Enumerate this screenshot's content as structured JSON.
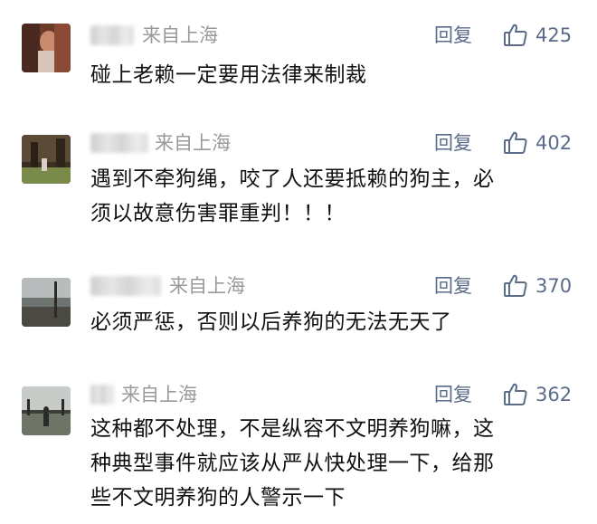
{
  "comments": [
    {
      "location": "来自上海",
      "reply_label": "回复",
      "likes": "425",
      "lines": [
        "碰上老赖一定要用法律来制裁"
      ]
    },
    {
      "location": "来自上海",
      "reply_label": "回复",
      "likes": "402",
      "lines": [
        "遇到不牵狗绳，咬了人还要抵赖的狗主，必",
        "须以故意伤害罪重判！！！"
      ]
    },
    {
      "location": "来自上海",
      "reply_label": "回复",
      "likes": "370",
      "lines": [
        "必须严惩，否则以后养狗的无法无天了"
      ]
    },
    {
      "location": "来自上海",
      "reply_label": "回复",
      "likes": "362",
      "lines": [
        "这种都不处理，不是纵容不文明养狗嘛，这",
        "种典型事件就应该从严从快处理一下，给那",
        "些不文明养狗的人警示一下"
      ]
    }
  ],
  "icons": {
    "avatar": "avatar-photo",
    "like": "thumbs-up-icon"
  },
  "colors": {
    "meta": "#5b6b8a",
    "location": "#9a9a9a",
    "text": "#111111"
  }
}
